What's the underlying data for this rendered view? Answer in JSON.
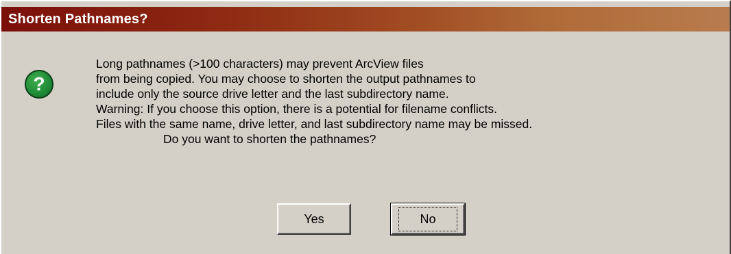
{
  "dialog": {
    "title": "Shorten Pathnames?",
    "icon": "question-icon",
    "icon_glyph": "?",
    "icon_color": "#1f8a36",
    "title_bar_color": "#7a0f0a",
    "message_lines": [
      "Long pathnames (>100 characters) may prevent ArcView files",
      "from being copied. You may choose to shorten the output pathnames to",
      "include only the source drive letter and the last subdirectory name.",
      "Warning: If you choose this option, there is a potential for filename conflicts.",
      "Files with the same name, drive letter, and last subdirectory name may be missed."
    ],
    "question": "Do you want to shorten the pathnames?",
    "buttons": {
      "yes_label": "Yes",
      "no_label": "No",
      "default": "No"
    }
  }
}
